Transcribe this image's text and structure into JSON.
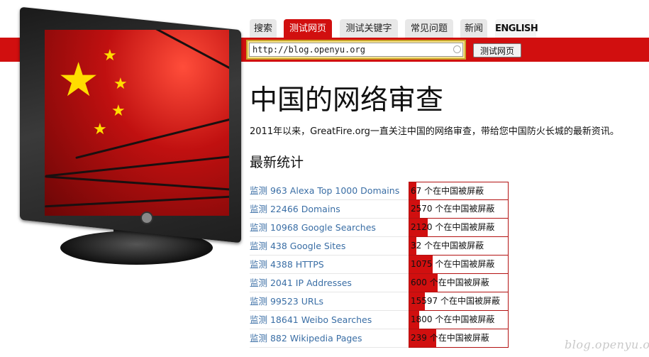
{
  "nav": {
    "tabs": [
      {
        "label": "搜索",
        "active": false
      },
      {
        "label": "测试网页",
        "active": true
      },
      {
        "label": "测试关键字",
        "active": false
      },
      {
        "label": "常见问题",
        "active": false
      },
      {
        "label": "新闻",
        "active": false
      },
      {
        "label": "ENGLISH",
        "active": false
      }
    ]
  },
  "search": {
    "value": "http://blog.openyu.org",
    "button_label": "测试网页"
  },
  "main": {
    "title": "中国的网络审查",
    "intro": "2011年以来，GreatFire.org一直关注中国的网络审查，带给您中国防火长城的最新资讯。",
    "section_title": "最新统计"
  },
  "stats": [
    {
      "link": "监测 963 Alexa Top 1000 Domains",
      "count": "67",
      "suffix": " 个在中国被屏蔽",
      "fraction": 0.07
    },
    {
      "link": "监测 22466 Domains",
      "count": "2570",
      "suffix": " 个在中国被屏蔽",
      "fraction": 0.11
    },
    {
      "link": "监测 10968 Google Searches",
      "count": "2120",
      "suffix": " 个在中国被屏蔽",
      "fraction": 0.19
    },
    {
      "link": "监测 438 Google Sites",
      "count": "32",
      "suffix": " 个在中国被屏蔽",
      "fraction": 0.07
    },
    {
      "link": "监测 4388 HTTPS",
      "count": "1075",
      "suffix": " 个在中国被屏蔽",
      "fraction": 0.24
    },
    {
      "link": "监测 2041 IP Addresses",
      "count": "600",
      "suffix": " 个在中国被屏蔽",
      "fraction": 0.29
    },
    {
      "link": "监测 99523 URLs",
      "count": "15597",
      "suffix": " 个在中国被屏蔽",
      "fraction": 0.16
    },
    {
      "link": "监测 18641 Weibo Searches",
      "count": "1800",
      "suffix": " 个在中国被屏蔽",
      "fraction": 0.1
    },
    {
      "link": "监测 882 Wikipedia Pages",
      "count": "239",
      "suffix": " 个在中国被屏蔽",
      "fraction": 0.27
    }
  ],
  "watermark": "blog.openyu.org",
  "colors": {
    "accent": "#d10f0f",
    "link": "#3a6ea5",
    "search_frame": "#c7a52a"
  },
  "icons": {
    "tv": "tv-with-china-flag-image",
    "clear": "clear-circle-icon"
  }
}
